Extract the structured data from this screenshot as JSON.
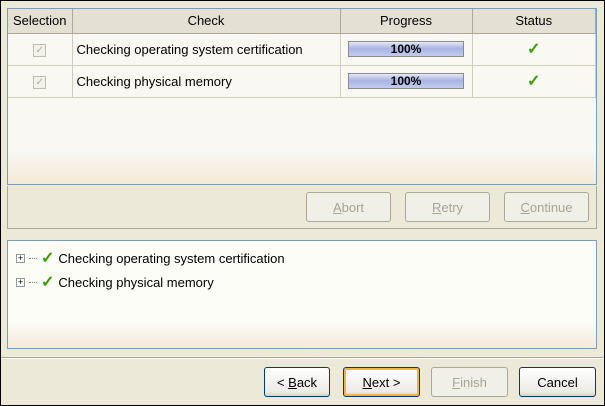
{
  "table": {
    "headers": [
      "Selection",
      "Check",
      "Progress",
      "Status"
    ],
    "rows": [
      {
        "check": "Checking operating system certification",
        "progress": "100%",
        "progress_value": 100,
        "status": "success"
      },
      {
        "check": "Checking physical memory",
        "progress": "100%",
        "progress_value": 100,
        "status": "success"
      }
    ]
  },
  "actions": {
    "abort_first": "A",
    "abort_rest": "bort",
    "retry_first": "R",
    "retry_rest": "etry",
    "continue_first": "C",
    "continue_rest": "ontinue"
  },
  "tree": [
    "Checking operating system certification",
    "Checking physical memory"
  ],
  "nav": {
    "back_pre": "< ",
    "back_first": "B",
    "back_rest": "ack",
    "next_first": "N",
    "next_rest": "ext >",
    "finish_first": "F",
    "finish_rest": "inish",
    "cancel": "Cancel"
  },
  "colors": {
    "success": "#3aa000",
    "accent": "#f8b33e"
  }
}
